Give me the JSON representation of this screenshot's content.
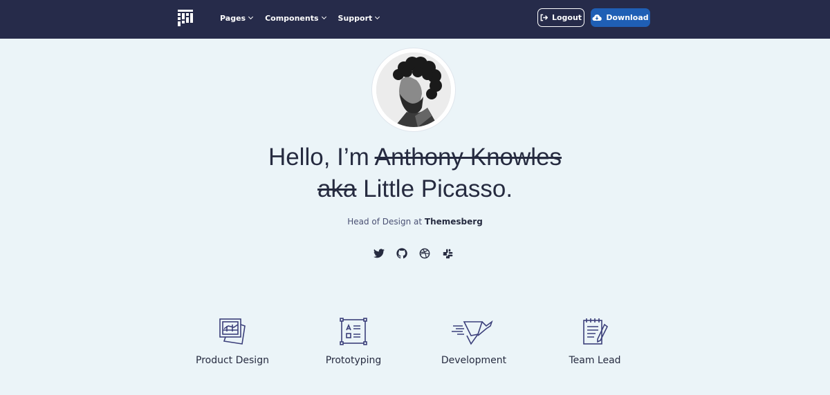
{
  "nav": {
    "brand_icon": "themesberg-logo-icon",
    "links": [
      "Pages",
      "Components",
      "Support"
    ],
    "logout_label": "Logout",
    "download_label": "Download",
    "logout_icon": "logout-icon",
    "download_icon": "cloud-download-icon"
  },
  "hero": {
    "greeting": "Hello, I’m ",
    "struck_name": "Anthony Knowles",
    "struck_aka": "aka",
    "nickname": " Little Picasso.",
    "subtitle_prefix": "Head of Design at ",
    "subtitle_company": "Themesberg",
    "social": [
      "twitter-icon",
      "github-icon",
      "dribbble-icon",
      "slack-icon"
    ]
  },
  "features": [
    {
      "label": "Product Design",
      "icon": "product-design-icon"
    },
    {
      "label": "Prototyping",
      "icon": "prototyping-icon"
    },
    {
      "label": "Development",
      "icon": "development-icon"
    },
    {
      "label": "Team Lead",
      "icon": "team-lead-icon"
    }
  ],
  "colors": {
    "navbar": "#262b4a",
    "background": "#ebf4f8",
    "accent": "#1f5fb5",
    "text": "#262b40",
    "icon_stroke": "#3b3f7a"
  }
}
